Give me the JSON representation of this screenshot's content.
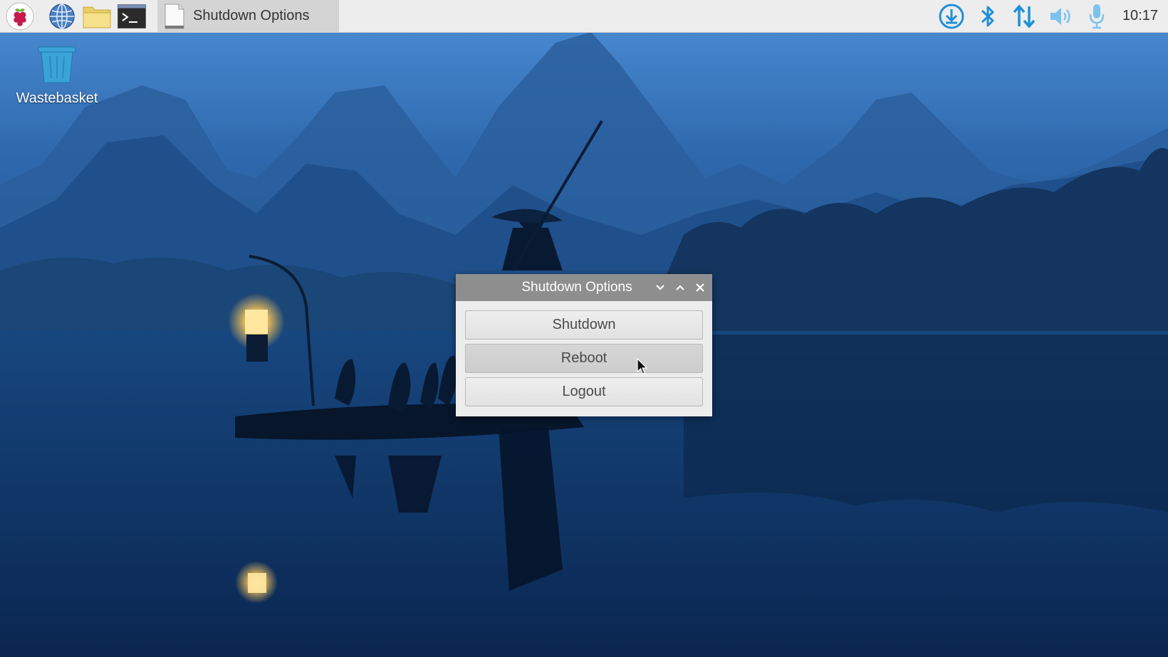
{
  "taskbar": {
    "launchers": [
      {
        "icon": "raspberry-menu-icon"
      },
      {
        "icon": "web-browser-icon"
      },
      {
        "icon": "file-manager-icon"
      },
      {
        "icon": "terminal-icon"
      }
    ],
    "task_button": {
      "label": "Shutdown Options",
      "icon": "document-icon"
    },
    "tray": [
      {
        "icon": "updater-download-icon"
      },
      {
        "icon": "bluetooth-icon"
      },
      {
        "icon": "network-arrows-icon"
      },
      {
        "icon": "volume-icon"
      },
      {
        "icon": "microphone-icon"
      }
    ],
    "clock": "10:17"
  },
  "desktop": {
    "icons": [
      {
        "label": "Wastebasket",
        "icon": "trash-icon"
      }
    ]
  },
  "dialog": {
    "title": "Shutdown Options",
    "controls": [
      "minimize",
      "maximize",
      "close"
    ],
    "buttons": [
      {
        "label": "Shutdown"
      },
      {
        "label": "Reboot"
      },
      {
        "label": "Logout"
      }
    ]
  },
  "colors": {
    "accent": "#1e90d8",
    "taskbar_bg": "#ededed",
    "titlebar_bg": "#8e8e8e",
    "dialog_bg": "#ededed"
  }
}
